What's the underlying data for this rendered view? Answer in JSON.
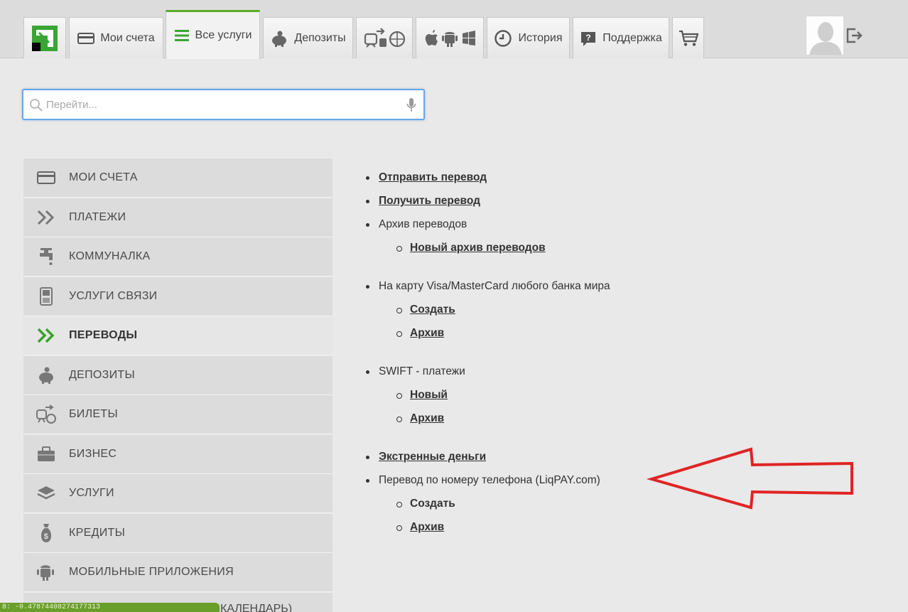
{
  "topnav": {
    "tabs": [
      {
        "label": "Мои счета",
        "icon": "card-icon"
      },
      {
        "label": "Все услуги",
        "icon": "list-icon",
        "active": true
      },
      {
        "label": "Депозиты",
        "icon": "piggy-bank-icon"
      },
      {
        "label": "",
        "icon": "tickets-icon"
      },
      {
        "label": "",
        "icon": "mobile-apps-icon"
      },
      {
        "label": "История",
        "icon": "history-icon"
      },
      {
        "label": "Поддержка",
        "icon": "support-icon"
      },
      {
        "label": "",
        "icon": "cart-icon"
      }
    ]
  },
  "search": {
    "placeholder": "Перейти..."
  },
  "sidebar": {
    "items": [
      {
        "label": "МОИ СЧЕТА",
        "icon": "card-icon"
      },
      {
        "label": "ПЛАТЕЖИ",
        "icon": "double-chevron-icon"
      },
      {
        "label": "КОММУНАЛКА",
        "icon": "faucet-icon"
      },
      {
        "label": "УСЛУГИ СВЯЗИ",
        "icon": "phone-icon"
      },
      {
        "label": "ПЕРЕВОДЫ",
        "icon": "double-chevron-icon",
        "active": true
      },
      {
        "label": "ДЕПОЗИТЫ",
        "icon": "piggy-bank-icon"
      },
      {
        "label": "БИЛЕТЫ",
        "icon": "tickets-icon"
      },
      {
        "label": "БИЗНЕС",
        "icon": "briefcase-icon"
      },
      {
        "label": "УСЛУГИ",
        "icon": "layers-icon"
      },
      {
        "label": "КРЕДИТЫ",
        "icon": "money-bag-icon"
      },
      {
        "label": "МОБИЛЬНЫЕ ПРИЛОЖЕНИЯ",
        "icon": "mobile-apps-icon"
      }
    ],
    "partial_item_tail": "КАЛЕНДАРЬ)"
  },
  "content": {
    "send_transfer": "Отправить перевод",
    "receive_transfer": "Получить перевод",
    "transfers_archive": "Архив переводов",
    "new_transfers_archive": "Новый архив переводов",
    "card_transfer": "На карту Visa/MasterCard любого банка мира",
    "card_create": "Создать",
    "card_archive": "Архив",
    "swift": "SWIFT - платежи",
    "swift_new": "Новый",
    "swift_archive": "Архив",
    "emergency_money": "Экстренные деньги",
    "phone_transfer": "Перевод по номеру телефона (LiqPAY.com)",
    "phone_create": "Создать",
    "phone_archive": "Архив"
  },
  "statusbar": {
    "text": "8: -0.47874408274177313"
  },
  "colors": {
    "accent_green": "#5bab2b",
    "annotation_red": "#e02424",
    "search_border": "#6aa6e8"
  }
}
